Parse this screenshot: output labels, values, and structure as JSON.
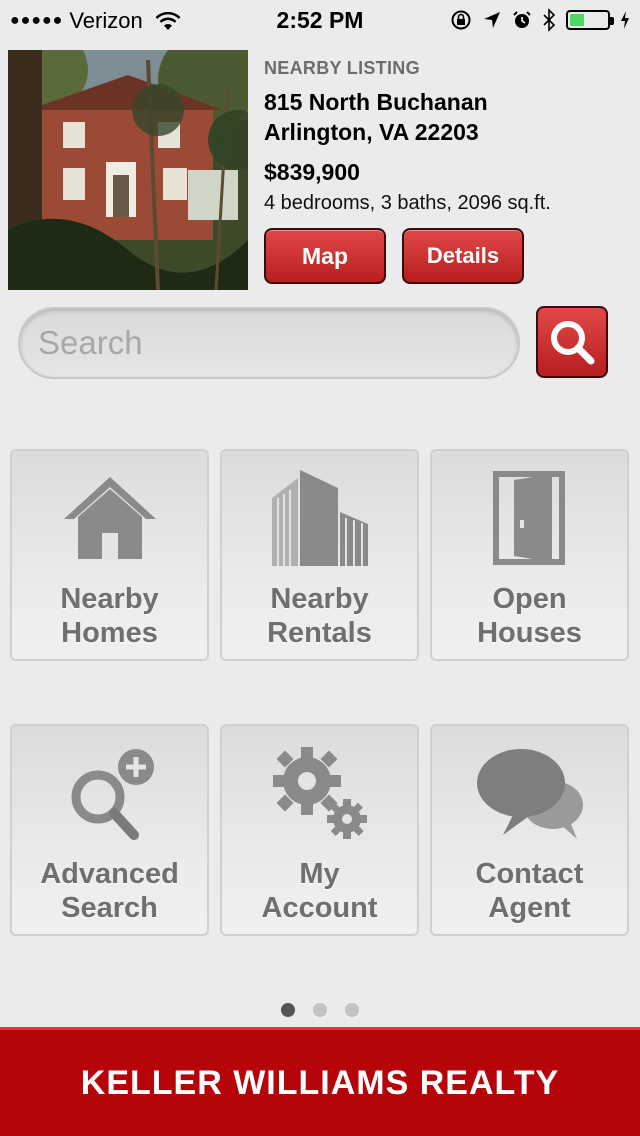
{
  "status_bar": {
    "signal_dots": "●●●●●",
    "carrier": "Verizon",
    "time": "2:52 PM",
    "battery_level": 0.4,
    "icons": [
      "wifi-icon",
      "rotation-lock-icon",
      "location-arrow-icon",
      "alarm-icon",
      "bluetooth-icon",
      "battery-icon",
      "charging-icon"
    ]
  },
  "listing": {
    "label": "NEARBY LISTING",
    "address_line1": "815 North Buchanan",
    "address_line2": "Arlington, VA 22203",
    "price": "$839,900",
    "specs": "4 bedrooms, 3 baths, 2096 sq.ft.",
    "map_button": "Map",
    "details_button": "Details"
  },
  "search": {
    "placeholder": "Search",
    "value": ""
  },
  "tiles": [
    {
      "line1": "Nearby",
      "line2": "Homes",
      "icon": "house-icon"
    },
    {
      "line1": "Nearby",
      "line2": "Rentals",
      "icon": "buildings-icon"
    },
    {
      "line1": "Open",
      "line2": "Houses",
      "icon": "door-icon"
    },
    {
      "line1": "Advanced",
      "line2": "Search",
      "icon": "magnifier-plus-icon"
    },
    {
      "line1": "My",
      "line2": "Account",
      "icon": "gears-icon"
    },
    {
      "line1": "Contact",
      "line2": "Agent",
      "icon": "chat-bubbles-icon"
    }
  ],
  "pagination": {
    "pages": 3,
    "current": 1
  },
  "footer": {
    "brand": "KELLER WILLIAMS REALTY"
  },
  "colors": {
    "brand_red": "#b5050a",
    "button_red": "#d03030",
    "tile_text": "#6f6f6f"
  }
}
